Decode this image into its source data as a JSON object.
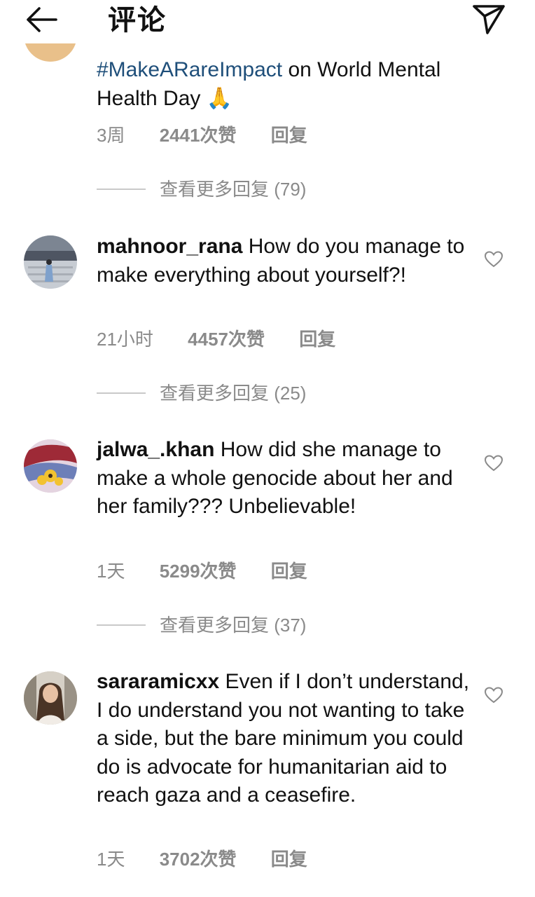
{
  "header": {
    "title": "评论"
  },
  "comments": [
    {
      "hashtag": "#MakeARareImpact",
      "text_after": " on World Mental Health Day",
      "emoji": "🙏",
      "time": "3周",
      "likes": "2441次赞",
      "reply": "回复",
      "more_replies": "查看更多回复 (79)"
    },
    {
      "username": "mahnoor_rana",
      "text": " How do you manage to make everything about yourself?!",
      "time": "21小时",
      "likes": "4457次赞",
      "reply": "回复",
      "more_replies": "查看更多回复 (25)"
    },
    {
      "username": "jalwa_.khan",
      "text": " How did she manage to make a whole genocide about her and her family??? Unbelievable!",
      "time": "1天",
      "likes": "5299次赞",
      "reply": "回复",
      "more_replies": "查看更多回复 (37)"
    },
    {
      "username": "sararamicxx",
      "text": " Even if I don’t understand, I do understand you not wanting to take a side, but the bare minimum you could do is advocate for humanitarian aid to reach gaza and a ceasefire.",
      "time": "1天",
      "likes": "3702次赞",
      "reply": "回复"
    }
  ],
  "colors": {
    "hashtag": "#1f4f7a",
    "meta": "#8a8a8a"
  },
  "icons": [
    "back-arrow-icon",
    "send-icon",
    "heart-icon"
  ]
}
